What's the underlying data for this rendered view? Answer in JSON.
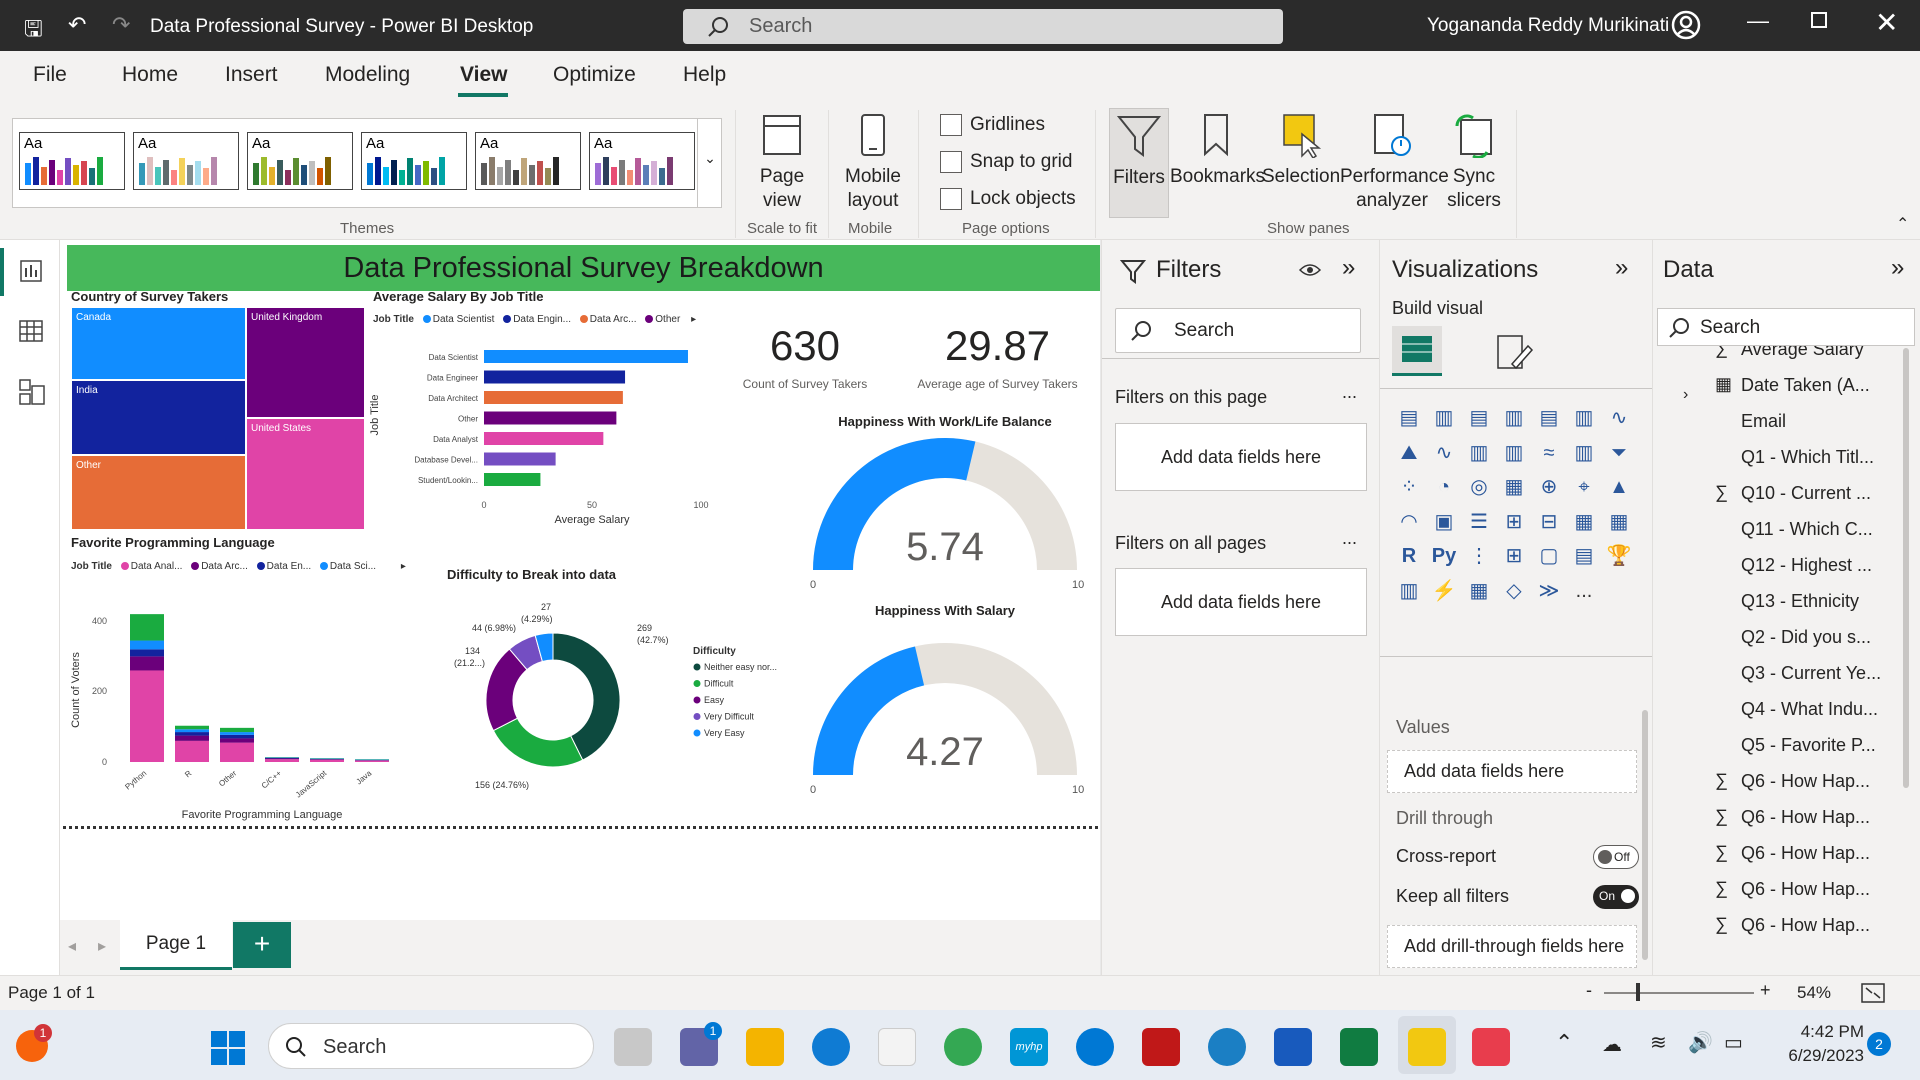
{
  "window": {
    "title": "Data Professional Survey - Power BI Desktop",
    "search_placeholder": "Search",
    "user_name": "Yogananda Reddy Murikinati"
  },
  "menu": [
    "File",
    "Home",
    "Insert",
    "Modeling",
    "View",
    "Optimize",
    "Help"
  ],
  "menu_active": "View",
  "ribbon": {
    "themes_label": "Themes",
    "theme_tile_text": "Aa",
    "page_view": "Page view",
    "scale_to_fit": "Scale to fit",
    "mobile_layout": "Mobile layout",
    "mobile": "Mobile",
    "gridlines": "Gridlines",
    "snap_to_grid": "Snap to grid",
    "lock_objects": "Lock objects",
    "page_options": "Page options",
    "filters": "Filters",
    "bookmarks": "Bookmarks",
    "selection": "Selection",
    "performance_analyzer": "Performance analyzer",
    "sync_slicers": "Sync slicers",
    "show_panes": "Show panes"
  },
  "report": {
    "banner": "Data Professional Survey Breakdown",
    "treemap": {
      "title": "Country of Survey Takers",
      "labels": [
        "Canada",
        "United Kingdom",
        "India",
        "United States",
        "Other"
      ]
    },
    "salary_chart": {
      "title": "Average Salary By Job Title",
      "legend_label": "Job Title",
      "legend_items": [
        "Data Scientist",
        "Data Engin...",
        "Data Arc...",
        "Other"
      ],
      "xlabel": "Average Salary",
      "ylabel": "Job Title",
      "ticks": [
        "0",
        "50",
        "100"
      ]
    },
    "kpi1": {
      "value": "630",
      "label": "Count of Survey Takers"
    },
    "kpi2": {
      "value": "29.87",
      "label": "Average age of Survey Takers"
    },
    "gauge1": {
      "title": "Happiness With Work/Life Balance",
      "value": "5.74",
      "min": "0",
      "max": "10"
    },
    "gauge2": {
      "title": "Happiness With Salary",
      "value": "4.27",
      "min": "0",
      "max": "10"
    },
    "lang_chart": {
      "title": "Favorite Programming Language",
      "legend_label": "Job Title",
      "legend_items": [
        "Data Anal...",
        "Data Arc...",
        "Data En...",
        "Data Sci..."
      ],
      "xlabel": "Favorite Programming Language",
      "ylabel": "Count of Voters",
      "yticks": [
        "400",
        "200",
        "0"
      ]
    },
    "donut": {
      "title": "Difficulty to Break into data",
      "legend_title": "Difficulty",
      "legend_items": [
        "Neither easy nor...",
        "Difficult",
        "Easy",
        "Very Difficult",
        "Very Easy"
      ],
      "labels": [
        "269",
        "(42.7%)",
        "156 (24.76%)",
        "134",
        "(21.2...)",
        "44 (6.98%)",
        "27",
        "(4.29%)"
      ]
    }
  },
  "chart_data": [
    {
      "type": "bar",
      "title": "Average Salary By Job Title",
      "orientation": "horizontal",
      "categories": [
        "Data Scientist",
        "Data Engineer",
        "Data Architect",
        "Other",
        "Data Analyst",
        "Database Devel...",
        "Student/Lookin..."
      ],
      "values": [
        94,
        65,
        64,
        61,
        55,
        33,
        26
      ],
      "colors": [
        "#118dff",
        "#12239e",
        "#e66c37",
        "#6b007b",
        "#e044a7",
        "#744ec2",
        "#1aab40"
      ],
      "xlabel": "Average Salary",
      "ylabel": "Job Title",
      "xlim": [
        0,
        100
      ]
    },
    {
      "type": "bar",
      "title": "Favorite Programming Language",
      "stacked": true,
      "categories": [
        "Python",
        "R",
        "Other",
        "C/C++",
        "JavaScript",
        "Java"
      ],
      "series": [
        {
          "name": "Data Anal...",
          "color": "#e044a7",
          "values": [
            260,
            60,
            55,
            8,
            6,
            4
          ]
        },
        {
          "name": "Data Arc...",
          "color": "#6b007b",
          "values": [
            40,
            15,
            12,
            2,
            2,
            1
          ]
        },
        {
          "name": "Data En...",
          "color": "#12239e",
          "values": [
            20,
            10,
            10,
            2,
            1,
            1
          ]
        },
        {
          "name": "Data Sci...",
          "color": "#118dff",
          "values": [
            25,
            8,
            8,
            1,
            1,
            1
          ]
        },
        {
          "name": "",
          "color": "#1aab40",
          "values": [
            75,
            10,
            12,
            1,
            1,
            1
          ]
        }
      ],
      "xlabel": "Favorite Programming Language",
      "ylabel": "Count of Voters",
      "ylim": [
        0,
        450
      ]
    },
    {
      "type": "pie",
      "title": "Difficulty to Break into data",
      "donut": true,
      "categories": [
        "Neither easy nor...",
        "Difficult",
        "Easy",
        "Very Difficult",
        "Very Easy"
      ],
      "values": [
        269,
        156,
        134,
        44,
        27
      ],
      "colors": [
        "#0d4a3f",
        "#1aab40",
        "#6b007b",
        "#744ec2",
        "#118dff"
      ]
    }
  ],
  "filters_pane": {
    "title": "Filters",
    "search": "Search",
    "on_this_page": "Filters on this page",
    "on_all_pages": "Filters on all pages",
    "add_fields": "Add data fields here",
    "more": "..."
  },
  "viz_pane": {
    "title": "Visualizations",
    "build_visual": "Build visual",
    "values": "Values",
    "add_data_fields": "Add data fields here",
    "drill_through": "Drill through",
    "cross_report": "Cross-report",
    "cross_report_state": "Off",
    "keep_all_filters": "Keep all filters",
    "keep_all_filters_state": "On",
    "add_drill_fields": "Add drill-through fields here",
    "r_icon": "R",
    "py_icon": "Py",
    "more_icon": "..."
  },
  "data_pane": {
    "title": "Data",
    "search": "Search",
    "fields": [
      {
        "label": "Average Salary",
        "sigma": true
      },
      {
        "label": "Date Taken (A...",
        "calendar": true
      },
      {
        "label": "Email"
      },
      {
        "label": "Q1 - Which Titl..."
      },
      {
        "label": "Q10 - Current ...",
        "sigma": true
      },
      {
        "label": "Q11 - Which C..."
      },
      {
        "label": "Q12 - Highest ..."
      },
      {
        "label": "Q13 - Ethnicity"
      },
      {
        "label": "Q2 - Did you s..."
      },
      {
        "label": "Q3 - Current Ye..."
      },
      {
        "label": "Q4 - What Indu..."
      },
      {
        "label": "Q5 - Favorite P..."
      },
      {
        "label": "Q6 - How Hap...",
        "sigma": true
      },
      {
        "label": "Q6 - How Hap...",
        "sigma": true
      },
      {
        "label": "Q6 - How Hap...",
        "sigma": true
      },
      {
        "label": "Q6 - How Hap...",
        "sigma": true
      },
      {
        "label": "Q6 - How Hap...",
        "sigma": true
      }
    ]
  },
  "page_tab": "Page 1",
  "status": {
    "page_info": "Page 1 of 1",
    "zoom": "54%"
  },
  "taskbar": {
    "search": "Search",
    "time": "4:42 PM",
    "date": "6/29/2023",
    "notifications": "2",
    "alert_badge": "1",
    "teams_badge": "1",
    "myhp": "myhp"
  }
}
